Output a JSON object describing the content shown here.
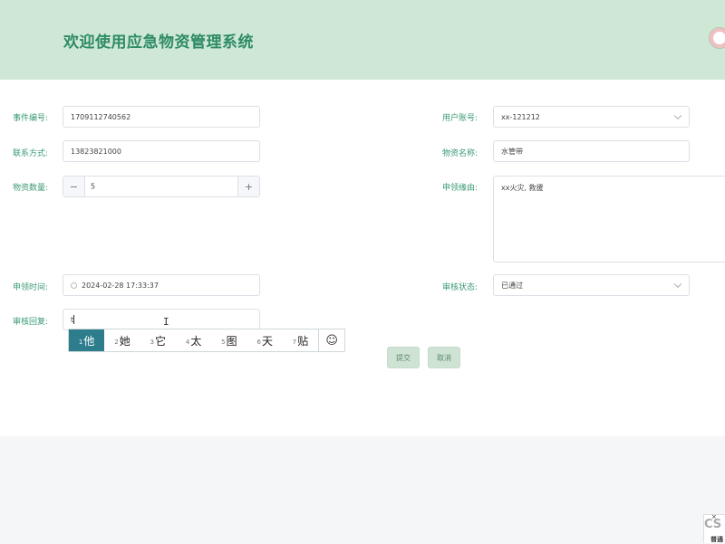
{
  "header": {
    "title": "欢迎使用应急物资管理系统"
  },
  "form": {
    "event_no": {
      "label": "事件编号:",
      "value": "1709112740562"
    },
    "user_account": {
      "label": "用户账号:",
      "value": "xx-121212"
    },
    "contact": {
      "label": "联系方式:",
      "value": "13823821000"
    },
    "material_name": {
      "label": "物资名称:",
      "value": "水管带"
    },
    "quantity": {
      "label": "物资数量:",
      "value": "5",
      "minus": "−",
      "plus": "+"
    },
    "reason": {
      "label": "申领缘由:",
      "value": "xx火灾, 救援"
    },
    "apply_time": {
      "label": "申领时间:",
      "value": "2024-02-28 17:33:37"
    },
    "review_status": {
      "label": "审核状态:",
      "value": "已通过"
    },
    "review_reply": {
      "label": "审核回复:",
      "value": "t"
    }
  },
  "ime": {
    "candidates": [
      {
        "num": "1",
        "text": "他"
      },
      {
        "num": "2",
        "text": "她"
      },
      {
        "num": "3",
        "text": "它"
      },
      {
        "num": "4",
        "text": "太"
      },
      {
        "num": "5",
        "text": "图"
      },
      {
        "num": "6",
        "text": "天"
      },
      {
        "num": "7",
        "text": "贴"
      }
    ],
    "emoji": "☺"
  },
  "buttons": {
    "submit": "提交",
    "cancel": "取消"
  },
  "widget": {
    "close": "×",
    "logo": "CS",
    "text": "普通"
  }
}
